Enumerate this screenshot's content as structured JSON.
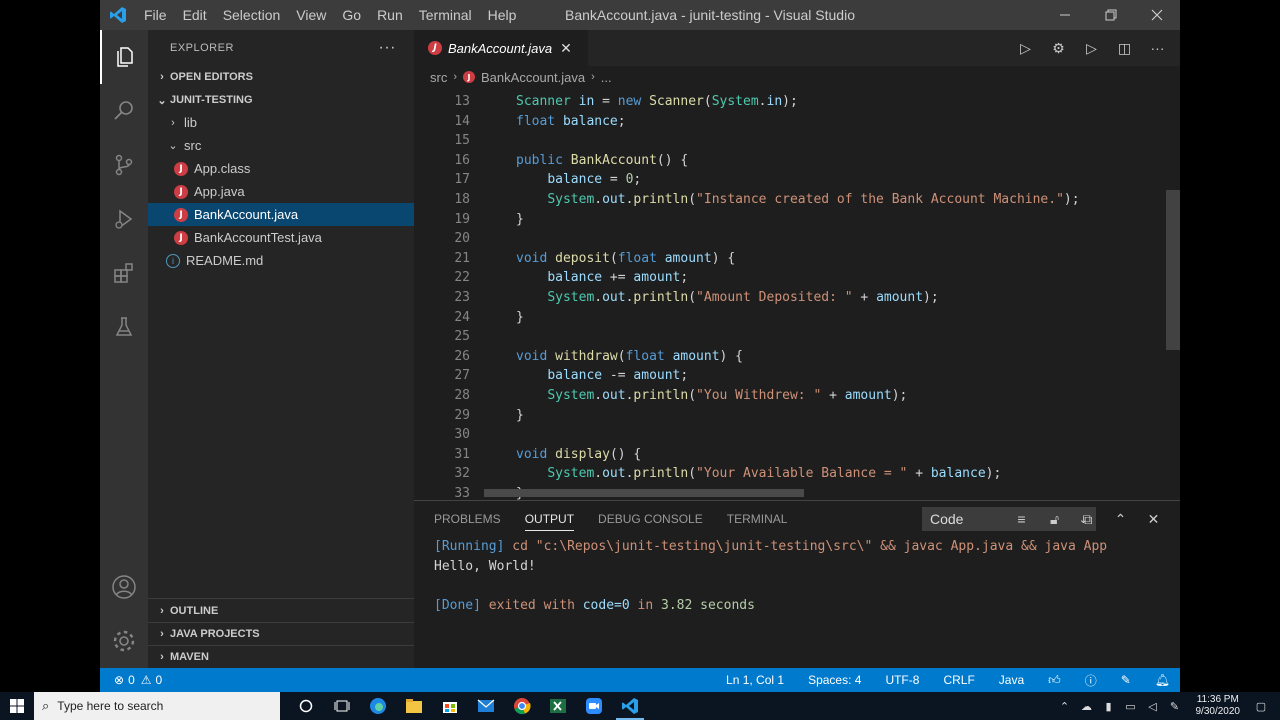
{
  "window": {
    "title": "BankAccount.java - junit-testing - Visual Studio Code",
    "menu": [
      "File",
      "Edit",
      "Selection",
      "View",
      "Go",
      "Run",
      "Terminal",
      "Help"
    ]
  },
  "sidebar": {
    "title": "EXPLORER",
    "open_editors": "OPEN EDITORS",
    "project": "JUNIT-TESTING",
    "tree": [
      {
        "label": "lib",
        "kind": "folder",
        "collapsed": true
      },
      {
        "label": "src",
        "kind": "folder",
        "collapsed": false
      },
      {
        "label": "App.class",
        "kind": "java-file"
      },
      {
        "label": "App.java",
        "kind": "java-file"
      },
      {
        "label": "BankAccount.java",
        "kind": "java-file",
        "selected": true
      },
      {
        "label": "BankAccountTest.java",
        "kind": "java-file"
      },
      {
        "label": "README.md",
        "kind": "info-file"
      }
    ],
    "bottom_sections": [
      "OUTLINE",
      "JAVA PROJECTS",
      "MAVEN"
    ]
  },
  "editor": {
    "tab_label": "BankAccount.java",
    "breadcrumb": [
      "src",
      "BankAccount.java",
      "..."
    ],
    "lines": [
      {
        "n": "13",
        "text": "    Scanner in = new Scanner(System.in);"
      },
      {
        "n": "14",
        "text": "    float balance;"
      },
      {
        "n": "15",
        "text": ""
      },
      {
        "n": "16",
        "text": "    public BankAccount() {"
      },
      {
        "n": "17",
        "text": "        balance = 0;"
      },
      {
        "n": "18",
        "text": "        System.out.println(\"Instance created of the Bank Account Machine.\");"
      },
      {
        "n": "19",
        "text": "    }"
      },
      {
        "n": "20",
        "text": ""
      },
      {
        "n": "21",
        "text": "    void deposit(float amount) {"
      },
      {
        "n": "22",
        "text": "        balance += amount;"
      },
      {
        "n": "23",
        "text": "        System.out.println(\"Amount Deposited: \" + amount);"
      },
      {
        "n": "24",
        "text": "    }"
      },
      {
        "n": "25",
        "text": ""
      },
      {
        "n": "26",
        "text": "    void withdraw(float amount) {"
      },
      {
        "n": "27",
        "text": "        balance -= amount;"
      },
      {
        "n": "28",
        "text": "        System.out.println(\"You Withdrew: \" + amount);"
      },
      {
        "n": "29",
        "text": "    }"
      },
      {
        "n": "30",
        "text": ""
      },
      {
        "n": "31",
        "text": "    void display() {"
      },
      {
        "n": "32",
        "text": "        System.out.println(\"Your Available Balance = \" + balance);"
      },
      {
        "n": "33",
        "text": "    }"
      }
    ]
  },
  "panel": {
    "tabs": [
      "PROBLEMS",
      "OUTPUT",
      "DEBUG CONSOLE",
      "TERMINAL"
    ],
    "active_tab": "OUTPUT",
    "channel": "Code",
    "output": {
      "running_tag": "[Running]",
      "running_cmd": "cd \"c:\\Repos\\junit-testing\\junit-testing\\src\\\" && javac App.java && java App",
      "hello": "Hello, World!",
      "done_tag": "[Done]",
      "done_text_1": "exited with",
      "done_code": "code=0",
      "done_text_2": "in",
      "done_time": "3.82 seconds"
    }
  },
  "statusbar": {
    "errors": "0",
    "warnings": "0",
    "position": "Ln 1, Col 1",
    "spaces": "Spaces: 4",
    "encoding": "UTF-8",
    "eol": "CRLF",
    "language": "Java"
  },
  "taskbar": {
    "search_placeholder": "Type here to search",
    "time": "11:36 PM",
    "date": "9/30/2020"
  },
  "colors": {
    "accent": "#007acc",
    "selection": "#094771",
    "java_icon": "#cc3e44"
  }
}
